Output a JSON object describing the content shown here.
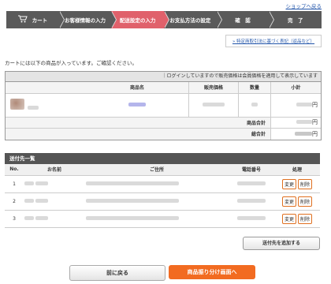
{
  "header": {
    "back_to_shop": "ショップへ戻る"
  },
  "steps": [
    {
      "label": "カート",
      "active": false
    },
    {
      "label": "お客様情報の入力",
      "active": false
    },
    {
      "label": "配送設定の入力",
      "active": true
    },
    {
      "label": "お支払方法の設定",
      "active": false
    },
    {
      "label": "確　認",
      "active": false
    },
    {
      "label": "完　了",
      "active": false
    }
  ],
  "legal_link": "» 特定商取引法に基づく表記（返品など）",
  "intro_text": "カートには以下の商品が入っています。ご確認ください。",
  "cart": {
    "notice": "｜ログインしていますので販売価格は会員価格を適用して表示しています",
    "headers": {
      "product": "商品名",
      "price": "販売価格",
      "qty": "数量",
      "subtotal": "小計"
    },
    "yen_suffix": "円",
    "product_total_label": "商品合計",
    "grand_total_label": "総合計",
    "yen_suffix_2": "円",
    "yen_suffix_3": "円"
  },
  "shipping": {
    "title": "送付先一覧",
    "headers": {
      "no": "No.",
      "name": "お名前",
      "address": "ご住所",
      "phone": "電話番号",
      "action": "処理"
    },
    "rows": [
      {
        "no": "1"
      },
      {
        "no": "2"
      },
      {
        "no": "3"
      }
    ],
    "edit_label": "変更",
    "delete_label": "削除",
    "add_button": "送付先を追加する"
  },
  "footer": {
    "back_button": "前に戻る",
    "next_button": "商品振り分け画面へ"
  },
  "colors": {
    "active_step": "#e0616b",
    "step_bg": "#5a5a5a",
    "primary": "#f26b21"
  }
}
